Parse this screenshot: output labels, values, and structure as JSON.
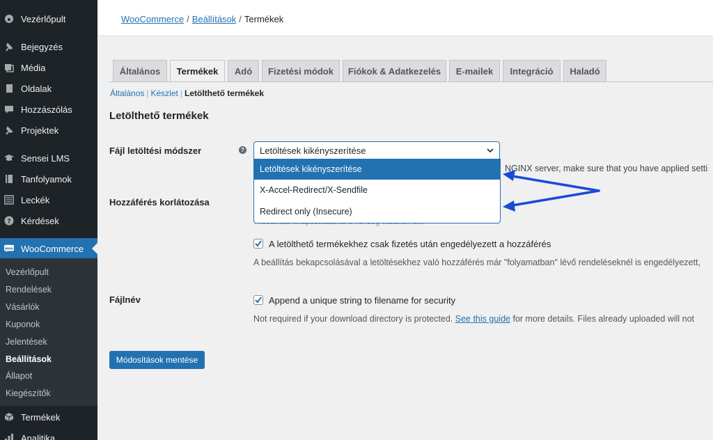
{
  "sidebar": {
    "items": [
      {
        "label": "Vezérlőpult",
        "icon": "dashboard-icon"
      },
      {
        "label": "Bejegyzés",
        "icon": "pin-icon"
      },
      {
        "label": "Média",
        "icon": "media-icon"
      },
      {
        "label": "Oldalak",
        "icon": "page-icon"
      },
      {
        "label": "Hozzászólás",
        "icon": "comment-icon"
      },
      {
        "label": "Projektek",
        "icon": "pin-icon"
      },
      {
        "label": "Sensei LMS",
        "icon": "graduation-cap-icon"
      },
      {
        "label": "Tanfolyamok",
        "icon": "book-icon"
      },
      {
        "label": "Leckék",
        "icon": "list-icon"
      },
      {
        "label": "Kérdések",
        "icon": "question-icon"
      },
      {
        "label": "WooCommerce",
        "icon": "woo-icon"
      },
      {
        "label": "Termékek",
        "icon": "box-icon"
      },
      {
        "label": "Analitika",
        "icon": "chart-icon"
      }
    ],
    "submenu": [
      "Vezérlőpult",
      "Rendelések",
      "Vásárlók",
      "Kuponok",
      "Jelentések",
      "Beállítások",
      "Állapot",
      "Kiegészítők"
    ]
  },
  "breadcrumb": {
    "part1": "WooCommerce",
    "part2": "Beállítások",
    "part3": "Termékek",
    "sep": "/"
  },
  "tabs": [
    "Általános",
    "Termékek",
    "Adó",
    "Fizetési módok",
    "Fiókok & Adatkezelés",
    "E-mailek",
    "Integráció",
    "Haladó"
  ],
  "subnav": {
    "a": "Általános",
    "b": "Készlet",
    "c": "Letölthető termékek",
    "bar": "|"
  },
  "section_title": "Letölthető termékek",
  "fields": {
    "download_method_label": "Fájl letöltési módszer",
    "access_label": "Hozzáférés korlátozása",
    "filename_label": "Fájlnév"
  },
  "select": {
    "value": "Letöltések kikényszerítése",
    "options": [
      "Letöltések kikényszerítése",
      "X-Accel-Redirect/X-Sendfile",
      "Redirect only (Insecure)"
    ]
  },
  "notes": {
    "nginx_tail": "NGINX server, make sure that you have applied setti",
    "partial_hidden": "A beállítás kikapcsolásával a vendég vásárlók is...",
    "access_checkbox": "A letölthető termékekhez csak fizetés után engedélyezett a hozzáférés",
    "access_desc": "A beállítás bekapcsolásával a letöltésekhez való hozzáférés már \"folyamatban\" lévő rendeléseknél is engedélyezett,",
    "filename_checkbox": "Append a unique string to filename for security",
    "filename_desc_pre": "Not required if your download directory is protected.",
    "filename_link": "See this guide",
    "filename_desc_post": "for more details. Files already uploaded will not"
  },
  "save_button": "Módosítások mentése",
  "colors": {
    "accent": "#2271b1",
    "sidebar": "#1d2327",
    "arrow": "#1a4bd6"
  }
}
